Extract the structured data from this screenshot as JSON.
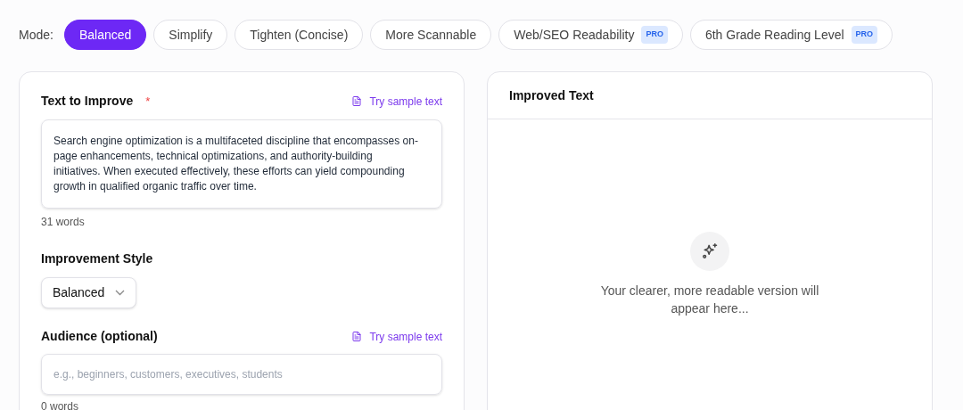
{
  "mode_bar": {
    "label": "Mode:",
    "modes": [
      {
        "label": "Balanced",
        "selected": true
      },
      {
        "label": "Simplify",
        "selected": false
      },
      {
        "label": "Tighten (Concise)",
        "selected": false
      },
      {
        "label": "More Scannable",
        "selected": false
      },
      {
        "label": "Web/SEO Readability",
        "selected": false,
        "badge": "PRO"
      },
      {
        "label": "6th Grade Reading Level",
        "selected": false,
        "badge": "PRO"
      }
    ]
  },
  "input_panel": {
    "text_field": {
      "label": "Text to Improve",
      "required_mark": "*",
      "sample_link": "Try sample text",
      "value": "Search engine optimization is a multifaceted discipline that encompasses on-page enhancements, technical optimizations, and authority-building initiatives. When executed effectively, these efforts can yield compounding growth in qualified organic traffic over time.",
      "word_count": "31 words"
    },
    "style": {
      "label": "Improvement Style",
      "value": "Balanced"
    },
    "audience": {
      "label": "Audience (optional)",
      "sample_link": "Try sample text",
      "placeholder": "e.g., beginners, customers, executives, students",
      "word_count": "0 words"
    }
  },
  "output_panel": {
    "title": "Improved Text",
    "empty_message": "Your clearer, more readable version will appear here..."
  }
}
